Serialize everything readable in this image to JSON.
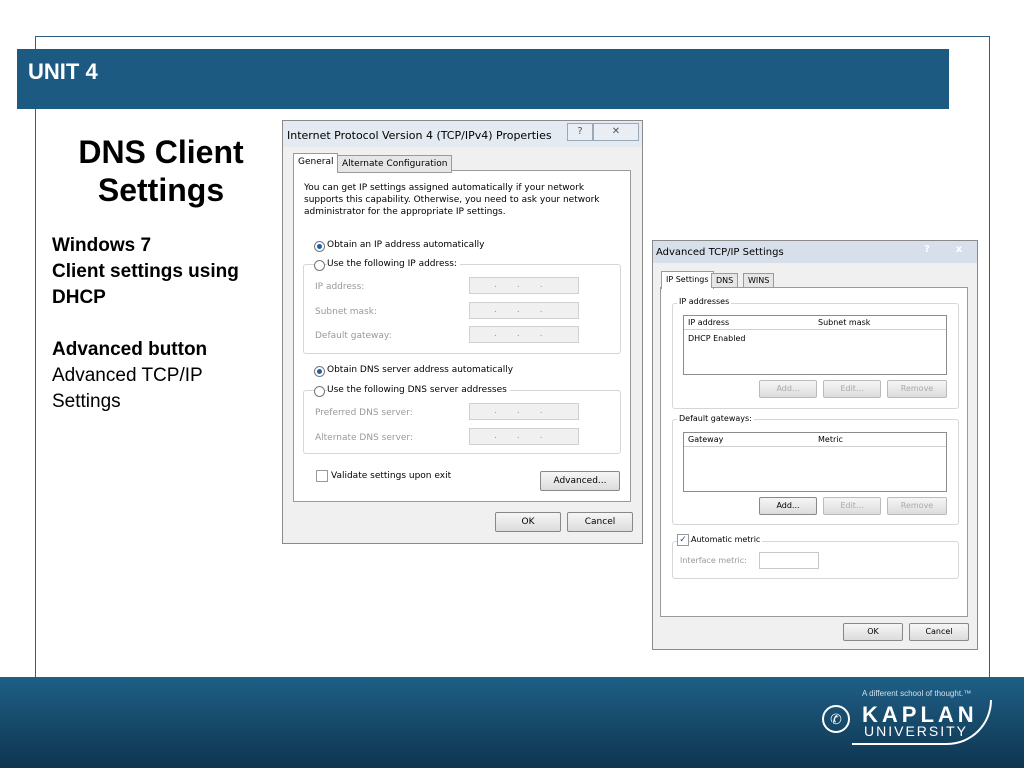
{
  "slide": {
    "unit_title": "UNIT 4",
    "title_line1": "DNS Client",
    "title_line2": "Settings",
    "bullets": {
      "line1": "Windows 7",
      "line2": "Client settings using",
      "line3": "DHCP",
      "line4": "Advanced button",
      "line5": "Advanced TCP/IP",
      "line6": "Settings"
    }
  },
  "footer": {
    "tagline": "A different school of thought.™",
    "logo_top": "KAPLAN",
    "logo_bottom": "UNIVERSITY",
    "colors": {
      "bar": "#1d5a82",
      "footer": "#0e3550"
    }
  },
  "ipv4_dialog": {
    "title": "Internet Protocol Version 4 (TCP/IPv4) Properties",
    "help_glyph": "?",
    "close_glyph": "✕",
    "tabs": [
      "General",
      "Alternate Configuration"
    ],
    "description": [
      "You can get IP settings assigned automatically if your network",
      "supports this capability. Otherwise, you need to ask your network",
      "administrator for the appropriate IP settings."
    ],
    "radio_auto_ip": "Obtain an IP address automatically",
    "radio_manual_ip": "Use the following IP address:",
    "ip_address_label": "IP address:",
    "subnet_label": "Subnet mask:",
    "gateway_label": "Default gateway:",
    "radio_auto_dns": "Obtain DNS server address automatically",
    "radio_manual_dns": "Use the following DNS server addresses",
    "preferred_dns_label": "Preferred DNS server:",
    "alternate_dns_label": "Alternate DNS server:",
    "ip_placeholder": "...",
    "validate_label": "Validate settings upon exit",
    "advanced_button": "Advanced...",
    "ok_button": "OK",
    "cancel_button": "Cancel"
  },
  "advanced_dialog": {
    "title": "Advanced TCP/IP Settings",
    "help_glyph": "?",
    "close_glyph": "x",
    "tabs": [
      "IP Settings",
      "DNS",
      "WINS"
    ],
    "ip_group_label": "IP addresses",
    "ip_headers": [
      "IP address",
      "Subnet mask"
    ],
    "ip_rows": [
      "DHCP Enabled"
    ],
    "gateway_group_label": "Default gateways:",
    "gateway_headers": [
      "Gateway",
      "Metric"
    ],
    "add_button": "Add...",
    "edit_button": "Edit...",
    "remove_button": "Remove",
    "automatic_metric_label": "Automatic metric",
    "interface_metric_label": "Interface metric:",
    "ok_button": "OK",
    "cancel_button": "Cancel"
  }
}
